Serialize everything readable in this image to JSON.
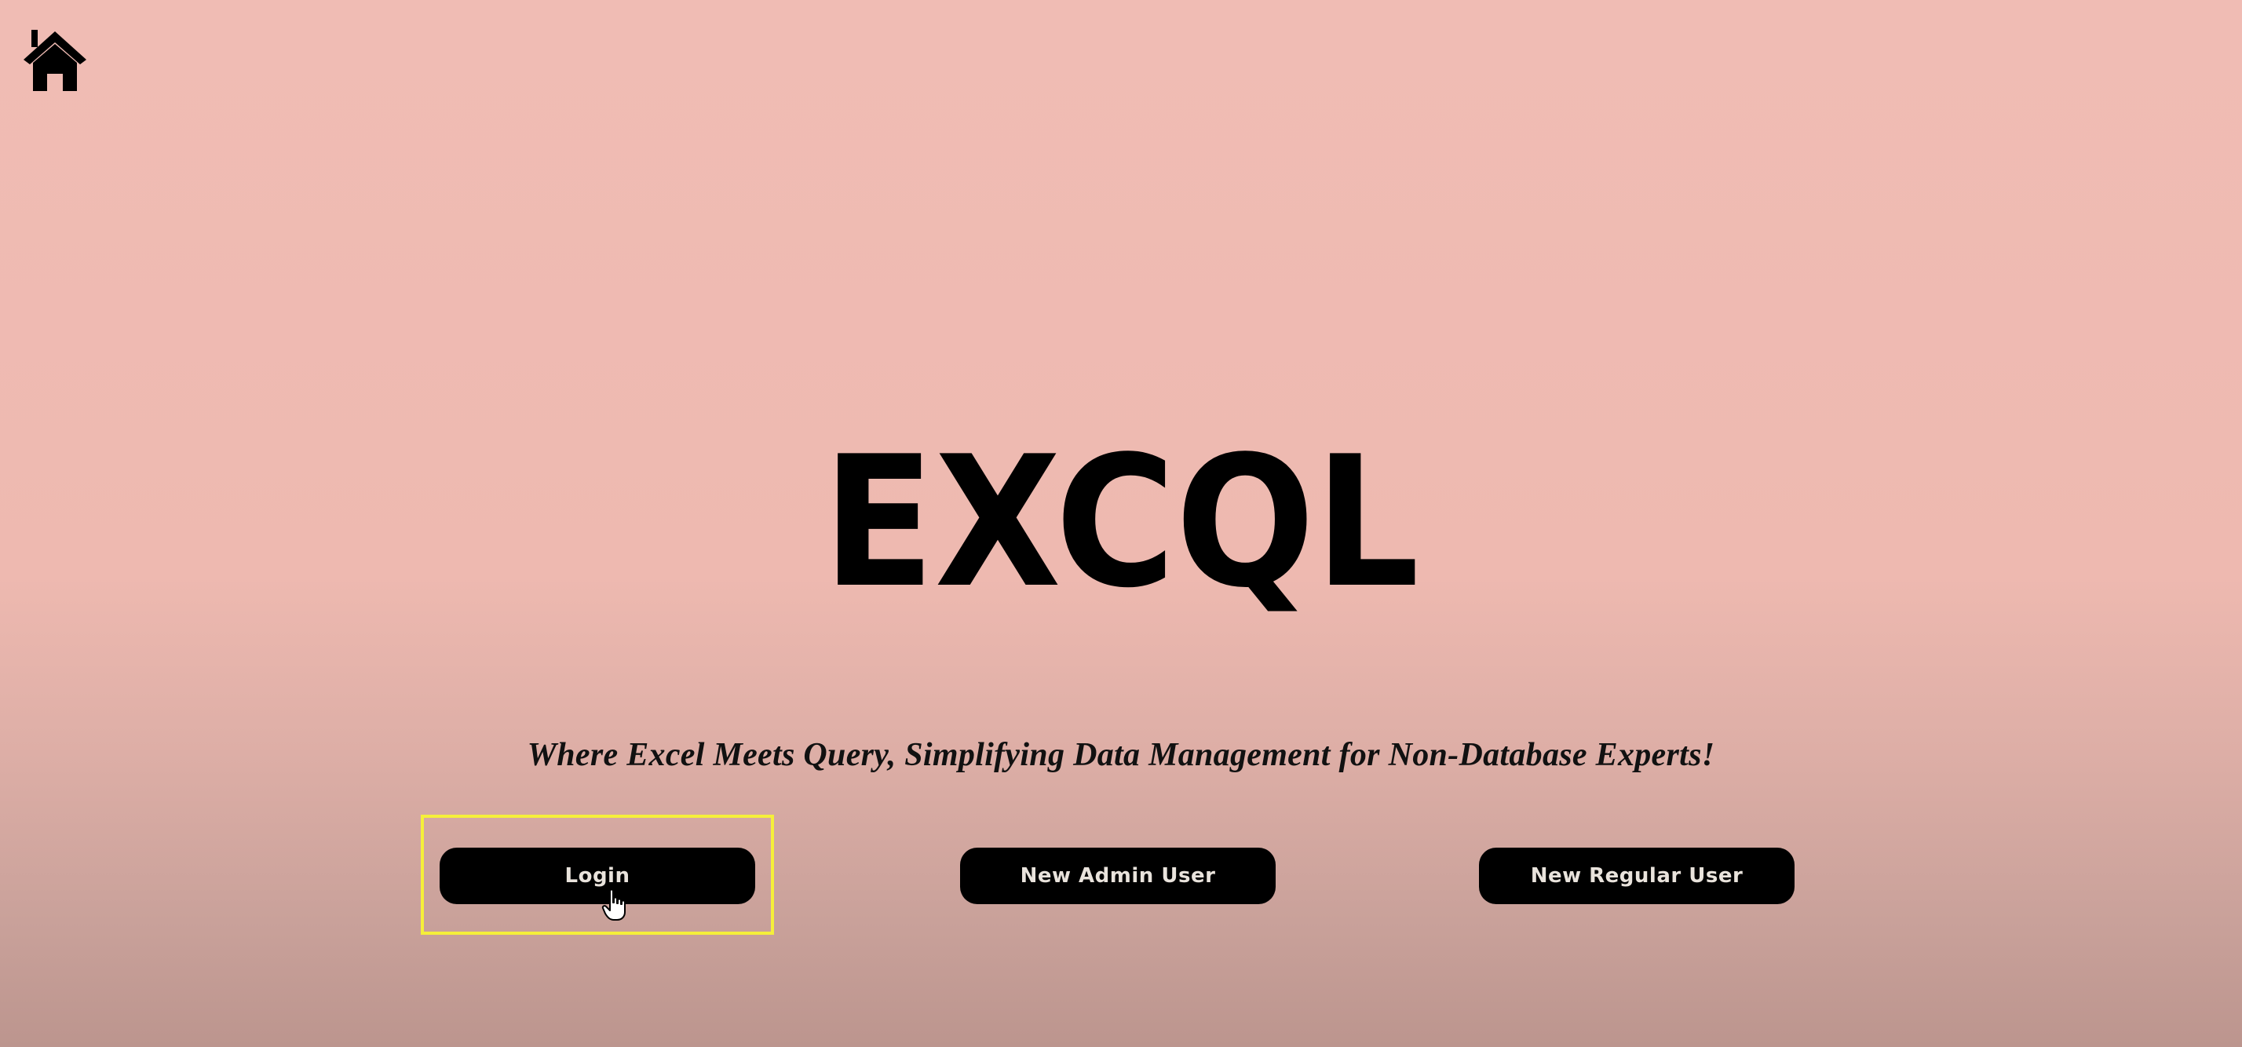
{
  "app": {
    "logo_text": "EXCQL",
    "tagline": "Where Excel Meets Query, Simplifying Data Management for Non-Database Experts!"
  },
  "nav": {
    "home_icon": "home-icon"
  },
  "actions": {
    "login_label": "Login",
    "new_admin_label": "New Admin User",
    "new_regular_label": "New Regular User"
  },
  "colors": {
    "background_top": "#f0bcb4",
    "background_bottom": "#bc958e",
    "button_bg": "#000000",
    "button_text": "#e9e3dc",
    "highlight": "#f5ef3a"
  },
  "focus": {
    "highlighted_button": "Login"
  }
}
